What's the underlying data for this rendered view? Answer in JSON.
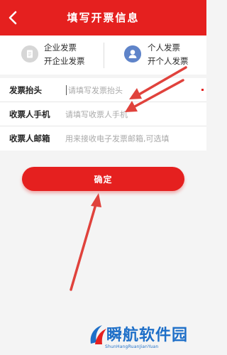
{
  "header": {
    "title": "填写开票信息",
    "background": "#e5201f"
  },
  "invoice_types": [
    {
      "id": "company",
      "line1": "企业发票",
      "line2": "开企业发票",
      "icon": "document-icon",
      "icon_color": "#d6d6d6"
    },
    {
      "id": "personal",
      "line1": "个人发票",
      "line2": "开个人发票",
      "icon": "person-icon",
      "icon_color": "#5f84c9"
    }
  ],
  "form": {
    "rows": [
      {
        "label": "发票抬头",
        "placeholder": "请填写发票抬头"
      },
      {
        "label": "收票人手机",
        "placeholder": "请填写收票人手机"
      },
      {
        "label": "收票人邮箱",
        "placeholder": "用来接收电子发票邮箱,可选填"
      }
    ]
  },
  "confirm_label": "确定",
  "watermark": {
    "name": "瞬航软件园",
    "url": "ShunHangRuanJianYuan"
  },
  "colors": {
    "accent": "#e5201f",
    "annotation_arrow": "#e0423c",
    "watermark": "#1e6fc8"
  }
}
